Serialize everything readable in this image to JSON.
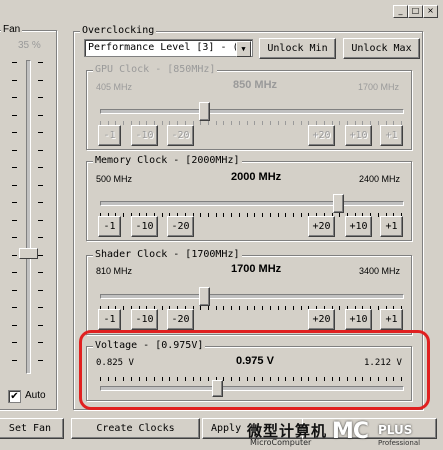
{
  "window": {
    "minimize_glyph": "_",
    "maximize_glyph": "□",
    "close_glyph": "×"
  },
  "fan": {
    "group_title": "Fan",
    "percent": "35 %",
    "auto_label": "Auto",
    "auto_checked": true,
    "set_button": "Set Fan"
  },
  "overclocking": {
    "group_title": "Overclocking",
    "perf_level": "Performance Level [3] - (",
    "unlock_min": "Unlock Min",
    "unlock_max": "Unlock Max"
  },
  "gpu_clock": {
    "title": "GPU Clock - [850MHz]",
    "min": "405 MHz",
    "current": "850 MHz",
    "max": "1700 MHz",
    "value_mhz": 850,
    "range": [
      405,
      1700
    ],
    "enabled": false,
    "buttons": [
      "-1",
      "-10",
      "-20",
      "+20",
      "+10",
      "+1"
    ]
  },
  "memory_clock": {
    "title": "Memory Clock - [2000MHz]",
    "min": "500 MHz",
    "current": "2000 MHz",
    "max": "2400 MHz",
    "value_mhz": 2000,
    "range": [
      500,
      2400
    ],
    "enabled": true,
    "buttons": [
      "-1",
      "-10",
      "-20",
      "+20",
      "+10",
      "+1"
    ]
  },
  "shader_clock": {
    "title": "Shader Clock - [1700MHz]",
    "min": "810 MHz",
    "current": "1700 MHz",
    "max": "3400 MHz",
    "value_mhz": 1700,
    "range": [
      810,
      3400
    ],
    "enabled": true,
    "buttons": [
      "-1",
      "-10",
      "-20",
      "+20",
      "+10",
      "+1"
    ]
  },
  "voltage": {
    "title": "Voltage - [0.975V]",
    "min": "0.825 V",
    "current": "0.975 V",
    "max": "1.212 V",
    "value_v": 0.975,
    "range": [
      0.825,
      1.212
    ]
  },
  "bottom": {
    "create_clocks": "Create Clocks",
    "apply_label": "Apply",
    "apply_clocks_partial": "Apply Clocks"
  },
  "watermark": {
    "chinese": "微型计算机",
    "roman": "MicroComputer",
    "logo": "MC",
    "logo_tail": "PLUS",
    "sub": "Professional"
  },
  "colors": {
    "highlight": "#e02020",
    "face": "#d4d0c8"
  }
}
